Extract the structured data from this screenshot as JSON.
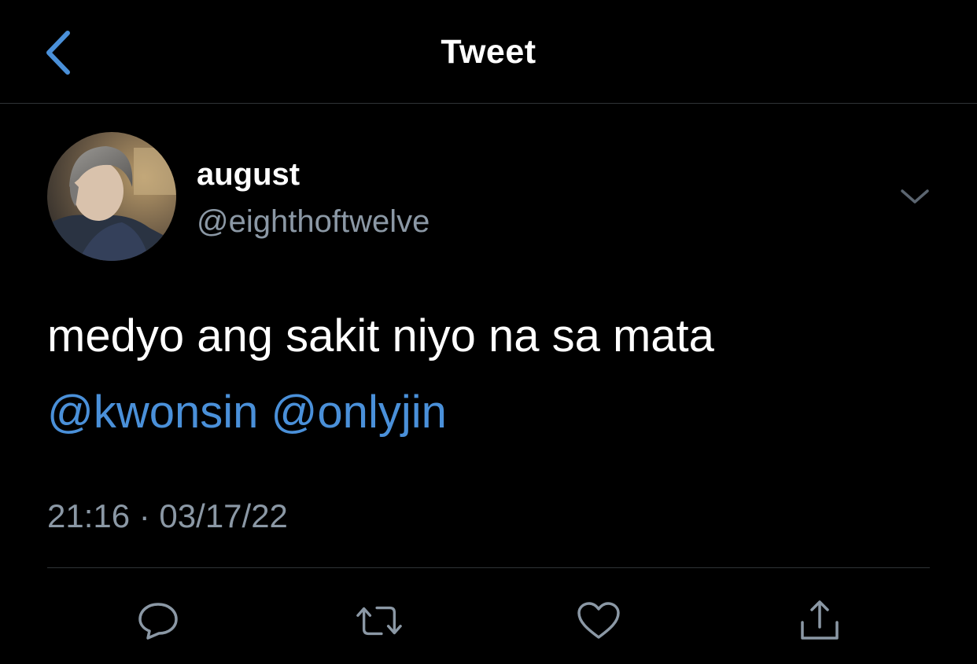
{
  "header": {
    "title": "Tweet",
    "back_icon": "chevron-left-icon",
    "accent_color": "#4a90d9"
  },
  "tweet": {
    "author": {
      "display_name": "august",
      "handle": "@eighthoftwelve"
    },
    "text": "medyo ang sakit niyo na sa mata",
    "mentions": [
      "@kwonsin",
      "@onlyjin"
    ],
    "timestamp": "21:16 · 03/17/22",
    "more_icon": "chevron-down-icon"
  },
  "actions": [
    {
      "icon": "reply-icon"
    },
    {
      "icon": "retweet-icon"
    },
    {
      "icon": "like-icon"
    },
    {
      "icon": "share-icon"
    }
  ],
  "colors": {
    "background": "#000000",
    "text": "#ffffff",
    "secondary": "#8b98a5",
    "link": "#4a90d9",
    "divider": "#2f3336"
  }
}
